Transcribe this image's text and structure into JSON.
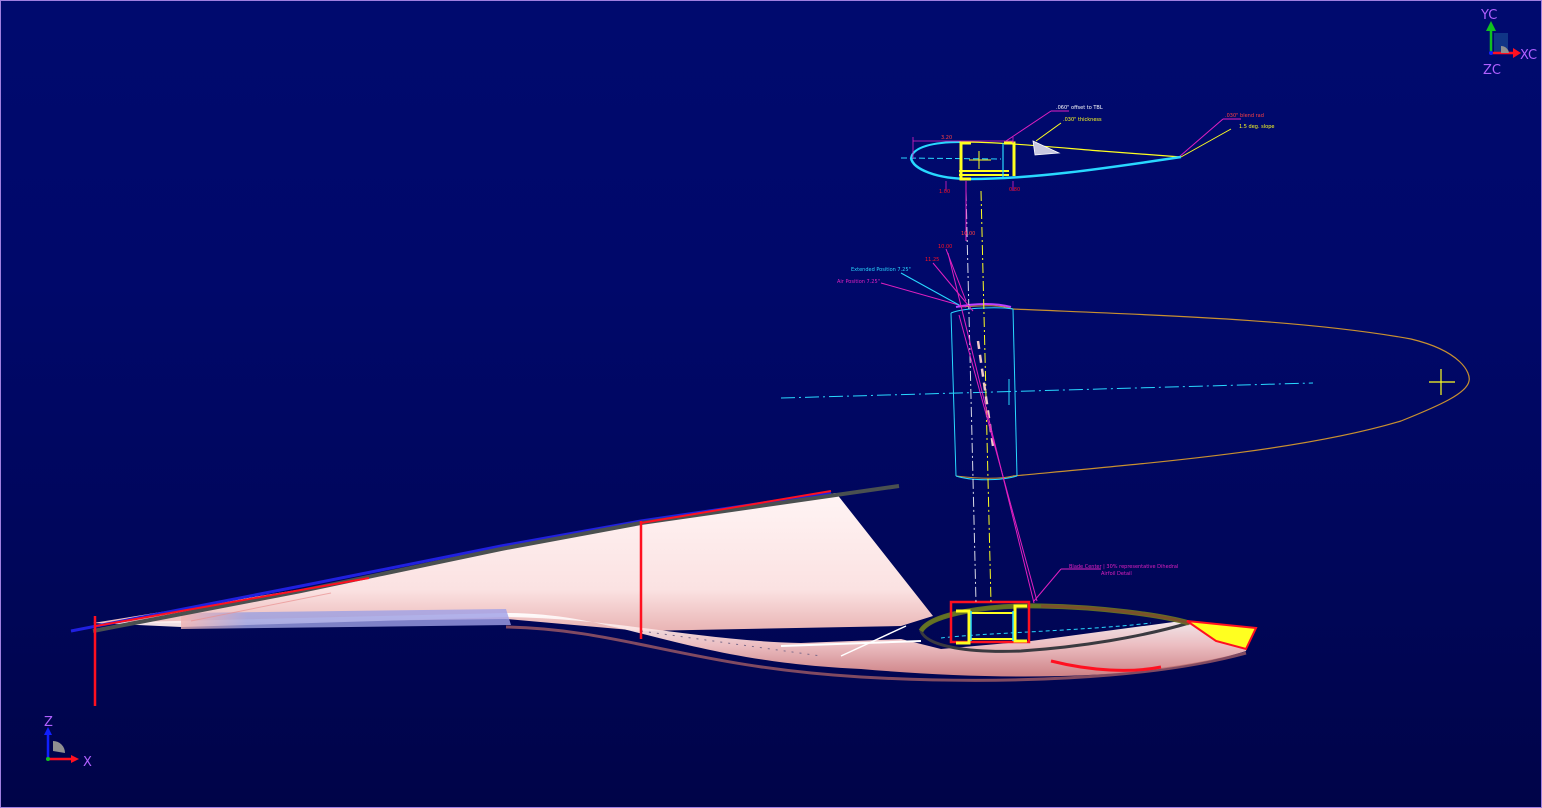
{
  "viewport": {
    "wcs_triad": {
      "y_label": "YC",
      "x_label": "XC",
      "z_label": "ZC"
    },
    "abs_triad": {
      "z_label": "Z",
      "x_label": "X"
    }
  },
  "annotations": {
    "top_section": {
      "note_offset": ".060\" offset to TBL",
      "note_thickness": ".030\" thickness",
      "note_blend": ".030\" blend rad",
      "note_slope": "1.5 deg. slope",
      "dim_width": "3.20",
      "dim_left": "1.00",
      "dim_right": "0.80"
    },
    "middle": {
      "dim_vertical": "10.00",
      "dim_a": "10.00",
      "dim_b": "11.25",
      "note_extended": "Extended Position 7.25\"",
      "note_retract": "Air Position 7.25\""
    },
    "bottom_section": {
      "note_line1": "Blade Center | 30% representative Dihedral",
      "note_line2": "Airfoil Detail"
    }
  },
  "colors": {
    "background_top": "#000a6e",
    "background_bottom": "#000448",
    "airfoil_outline": "#28d8ff",
    "spar_yellow": "#ffff20",
    "dimension_red": "#ff1020",
    "leader_magenta": "#e020c0",
    "pod_outline": "#c89030",
    "wing_pink": "#fde4e4"
  }
}
